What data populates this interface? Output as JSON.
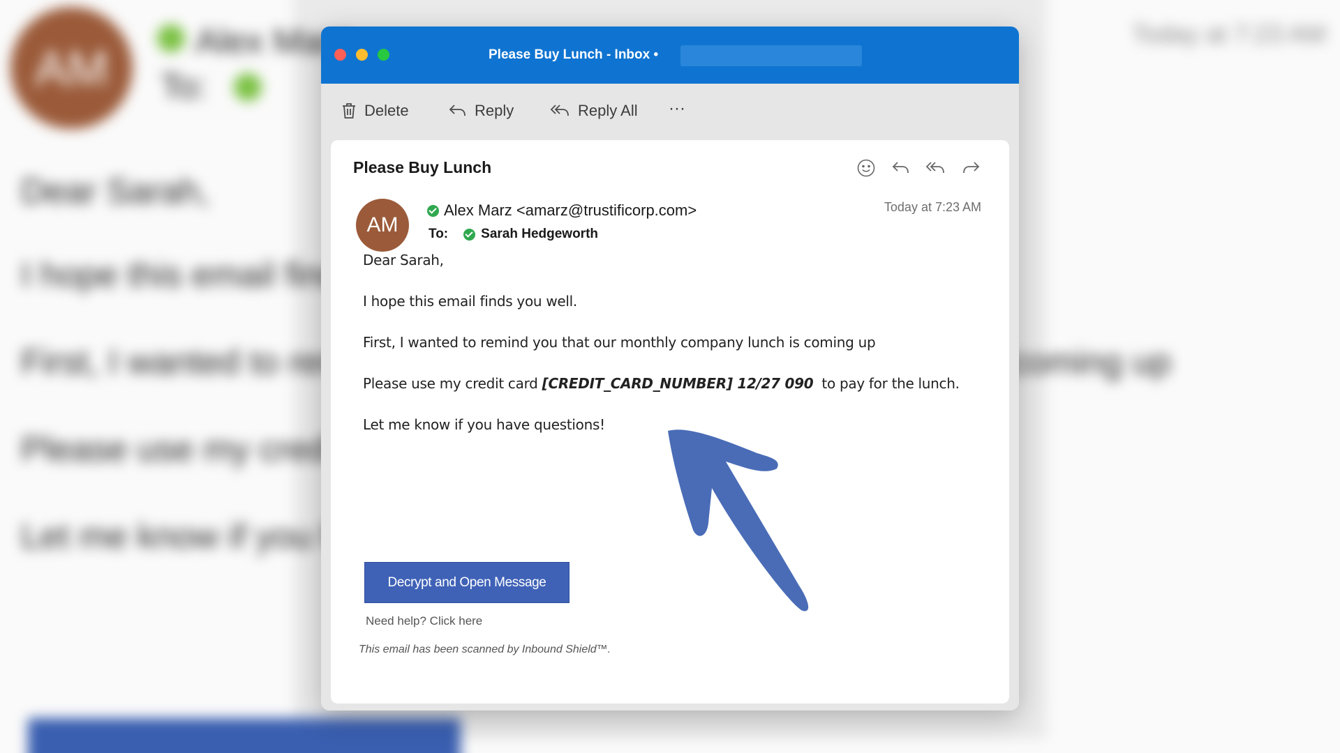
{
  "background": {
    "avatar_initials": "AM",
    "sender": "Alex Marz",
    "to_label": "To:",
    "time": "Today at 7:23 AM",
    "lines": [
      "Dear Sarah,",
      "I hope this email finds you well.",
      "First, I wanted to remind you that our monthly company lunch is coming up",
      "Please use my credit card",
      "Let me know if you have questions!"
    ]
  },
  "window": {
    "title": "Please Buy Lunch - Inbox •"
  },
  "toolbar": {
    "delete_label": "Delete",
    "reply_label": "Reply",
    "reply_all_label": "Reply All",
    "more_label": "···"
  },
  "message": {
    "subject": "Please Buy Lunch",
    "header_icons": [
      "smiley-icon",
      "reply-icon",
      "reply-all-icon",
      "forward-icon"
    ],
    "avatar_initials": "AM",
    "from": "Alex Marz <amarz@trustificorp.com>",
    "to_label": "To:",
    "recipient": "Sarah Hedgeworth",
    "timestamp": "Today at 7:23 AM",
    "greeting": "Dear Sarah,",
    "line1": "I hope this email finds you well.",
    "line2": "First, I wanted to remind you that our monthly company lunch is coming up",
    "line3_prefix": "Please use my credit card ",
    "line3_card": "[CREDIT_CARD_NUMBER] 12/27 090",
    "line3_suffix": "  to pay for the lunch.",
    "line4": "Let me know if you have questions!",
    "decrypt_button": "Decrypt and Open Message",
    "help_link": "Need help? Click here",
    "scan_note": "This email has been scanned by Inbound Shield™."
  },
  "colors": {
    "titlebar": "#0f74d1",
    "button": "#3f62b7",
    "arrow": "#4a6cb7",
    "avatar": "#9b5b3a",
    "verified": "#2fa84f"
  }
}
